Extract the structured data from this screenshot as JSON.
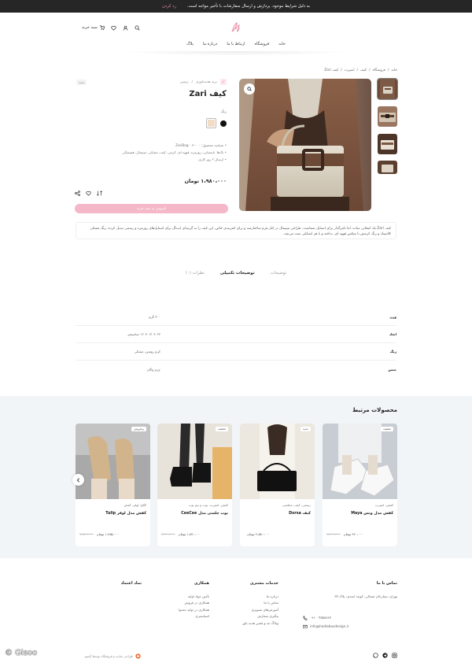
{
  "topbar": {
    "message": "به دلیل شرایط موجود، پردازش و ارسال سفارشات با تأخیر مواجه است.",
    "close_label": "رد کردن"
  },
  "header": {
    "cart_label": "سبد خرید",
    "nav": [
      "خانه",
      "فروشگاه",
      "ارتباط با ما",
      "درباره ما",
      "بلاگ"
    ]
  },
  "breadcrumb": [
    "خانه",
    "فروشگاه",
    "کیف",
    "اسپرت",
    "کیف Zari"
  ],
  "product": {
    "brand": "برند هدیه‌باوری",
    "category": "زنیس",
    "badge": "جدید",
    "title": "کیف Zari",
    "color_label": "رنگ",
    "colors": [
      "#f3dcc5",
      "#111111"
    ],
    "sku": "• شناسه محصول: ZariBag۰۰۳-۰۰۰",
    "tags": "• تگ‌ها: تابستانی، روزمره، قهوه ای، کرمی، کیف، مشکی، مینیمال، همیشگی",
    "shipping": "• ارسال ۲ روز کاری",
    "price": "۱،۹۸۰،۰۰۰ تومان",
    "add_to_cart": "افزودن به سبد خرید",
    "description": "کیف Zari یک انتخابی ساده، اما تاثیرگذار برای استایل شماست. طراحی مینیمال در کنار فرم ساختارمند و برای کمربندی خاص، این کیف را به گزینه‌ای ایده‌آل برای استایل‌های روزمره و رسمی تبدیل کرده؛ رنگ مشکی کلاسیک و رنگ کرمش با میکس قهوه ای، بداخته و با هر استایلی ست می‌شه."
  },
  "tabs": [
    "توضیحات",
    "توضیحات تکمیلی",
    "نظرات (۰)"
  ],
  "attributes": [
    {
      "key": "وزن",
      "value": "۳۰۰ گرم"
    },
    {
      "key": "ابعاد",
      "value": "۲۶ × ۱۲ × ۱۶ سانتیمتر"
    },
    {
      "key": "رنگ",
      "value": "کرم روشن، مشکی"
    },
    {
      "key": "جنس",
      "value": "چرم وگان"
    }
  ],
  "related": {
    "title": "محصولات مرتبط",
    "cards": [
      {
        "tag": "تخفیف",
        "category": "کفش، اسپرت",
        "name": "کفش مدل ونس Maya",
        "price": "۹۶۰،۰۰۰ تومان",
        "old_price": "۱،۲۰۰،۰۰۰"
      },
      {
        "tag": "جدید",
        "category": "رسمی، کیف، مجلسی",
        "name": "کیف Dorsa",
        "price": "۲،۸۵۰،۰۰۰ تومان",
        "old_price": ""
      },
      {
        "tag": "تخفیف",
        "category": "کفش، اسپرت، بوت و نیم بوت",
        "name": "بوت چلسی مدل CeeCee",
        "price": "۱،۸۷۰،۰۰۰ تومان",
        "old_price": "۲،۲۰۰،۰۰۰"
      },
      {
        "tag": "پرفروش",
        "category": "کالج، لوفر، کفش",
        "name": "کفش مدل لوفر Tulip",
        "price": "۱،۶۸۵،۰۰۰ تومان",
        "old_price": "۱،۸۷۰،۰۰۰"
      }
    ]
  },
  "footer": {
    "contact": {
      "heading": "تماس با ما",
      "address": "تهران، ستارخان شمالی، کوچه اسدی، پلاک ۳۷",
      "phone": "۰۹۱۰۰۴۵۵۸۸۶۷",
      "email": "info@hediebavdesign.ir"
    },
    "services": {
      "heading": "خدمات مشتری",
      "items": [
        "درباره ما",
        "تماس با ما",
        "آموزش‌های تصویری",
        "پیگیری سفارش",
        "وبلاگ مد و فشن هدیه باور"
      ]
    },
    "cooperation": {
      "heading": "همکاری",
      "items": [
        "تأمین مواد اولیه",
        "همکاری در فروش",
        "همکاری در تولید محتوا",
        "اسپانسری"
      ]
    },
    "trust": {
      "heading": "نماد اعتماد"
    },
    "credit": "طراحی سایت و فروشگاه توسط گیسو",
    "watermark": "© Gisoo"
  }
}
